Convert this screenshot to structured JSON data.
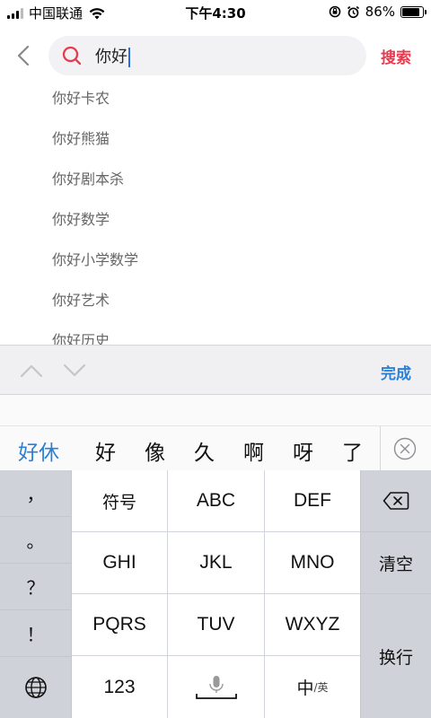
{
  "status_bar": {
    "carrier": "中国联通",
    "time": "下午4:30",
    "battery_percent": "86%",
    "battery_level": 0.86,
    "icons": [
      "signal-icon",
      "wifi-icon",
      "rotation-lock-icon",
      "alarm-icon",
      "battery-icon"
    ]
  },
  "search": {
    "query": "你好",
    "submit_label": "搜索",
    "accent_color": "#e83a4f"
  },
  "suggestions": [
    "你好卡农",
    "你好熊猫",
    "你好剧本杀",
    "你好数学",
    "你好小学数学",
    "你好艺术",
    "你好历史"
  ],
  "toolbar": {
    "done_label": "完成",
    "done_color": "#2b7fd4"
  },
  "candidates": {
    "items": [
      "好休",
      "好",
      "像",
      "久",
      "啊",
      "呀",
      "了"
    ]
  },
  "keyboard": {
    "punctuation": [
      "，",
      "。",
      "？",
      "！"
    ],
    "grid": [
      [
        "符号",
        "ABC",
        "DEF"
      ],
      [
        "GHI",
        "JKL",
        "MNO"
      ],
      [
        "PQRS",
        "TUV",
        "WXYZ"
      ]
    ],
    "delete_icon": "backspace-icon",
    "clear_label": "清空",
    "newline_label": "换行",
    "globe_icon": "globe-icon",
    "numbers_label": "123",
    "mic_icon": "microphone-icon",
    "lang_main": "中",
    "lang_sub": "/英"
  }
}
